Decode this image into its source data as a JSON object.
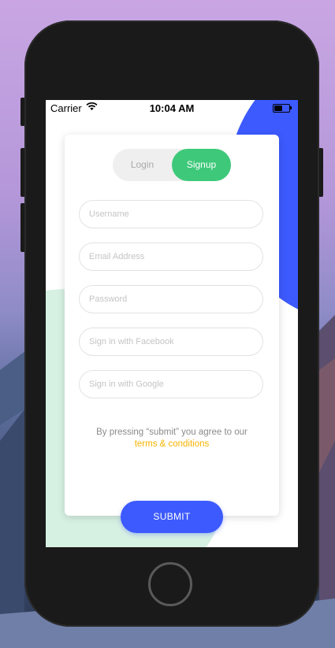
{
  "status_bar": {
    "carrier": "Carrier",
    "time": "10:04 AM"
  },
  "auth_toggle": {
    "login_label": "Login",
    "signup_label": "Signup",
    "selected": "Signup"
  },
  "form": {
    "username_placeholder": "Username",
    "email_placeholder": "Email Address",
    "password_placeholder": "Password",
    "facebook_placeholder": "Sign in with Facebook",
    "google_placeholder": "Sign in with Google"
  },
  "terms": {
    "text": "By pressing “submit” you agree to our",
    "link": "terms & conditions"
  },
  "submit_label": "SUBMIT",
  "colors": {
    "accent_blue": "#3d5afe",
    "accent_green": "#3ec97a",
    "link_yellow": "#f5b400",
    "green_blob": "#d6f0e2"
  }
}
